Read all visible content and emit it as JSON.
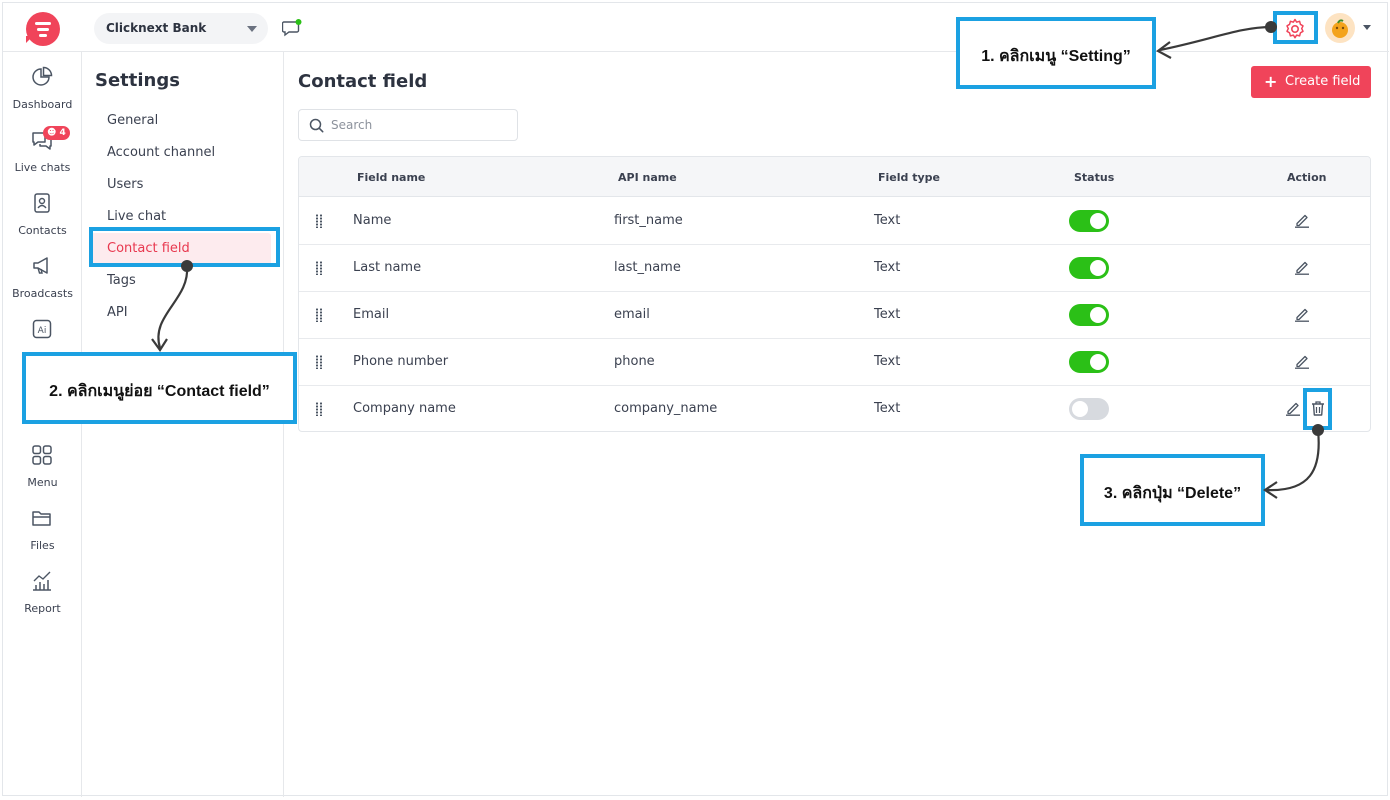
{
  "topbar": {
    "account_name": "Clicknext Bank"
  },
  "rail": {
    "items": [
      {
        "label": "Dashboard",
        "icon": "pie-chart-icon"
      },
      {
        "label": "Live chats",
        "icon": "chat-bubbles-icon",
        "badge": "4"
      },
      {
        "label": "Contacts",
        "icon": "contact-book-icon"
      },
      {
        "label": "Broadcasts",
        "icon": "megaphone-icon"
      },
      {
        "label": "Ai",
        "icon": "ai-icon"
      },
      {
        "label": "Menu",
        "icon": "grid-icon"
      },
      {
        "label": "Files",
        "icon": "folder-icon"
      },
      {
        "label": "Report",
        "icon": "report-chart-icon"
      }
    ]
  },
  "settings": {
    "title": "Settings",
    "items": [
      "General",
      "Account channel",
      "Users",
      "Live chat",
      "Contact field",
      "Tags",
      "API"
    ],
    "active": "Contact field"
  },
  "main": {
    "title": "Contact field",
    "create_label": "Create field",
    "search_placeholder": "Search",
    "columns": [
      "Field name",
      "API name",
      "Field type",
      "Status",
      "Action"
    ],
    "rows": [
      {
        "field_name": "Name",
        "api_name": "first_name",
        "field_type": "Text",
        "enabled": true
      },
      {
        "field_name": "Last name",
        "api_name": "last_name",
        "field_type": "Text",
        "enabled": true
      },
      {
        "field_name": "Email",
        "api_name": "email",
        "field_type": "Text",
        "enabled": true
      },
      {
        "field_name": "Phone number",
        "api_name": "phone",
        "field_type": "Text",
        "enabled": true
      },
      {
        "field_name": "Company name",
        "api_name": "company_name",
        "field_type": "Text",
        "enabled": false
      }
    ]
  },
  "annotations": {
    "step1": "1. คลิกเมนู “Setting”",
    "step2": "2. คลิกเมนูย่อย “Contact field”",
    "step3": "3. คลิกปุ่ม “Delete”"
  },
  "colors": {
    "brand": "#f0445a",
    "toggle_on": "#2bc017",
    "annotation": "#1ba1e2"
  }
}
